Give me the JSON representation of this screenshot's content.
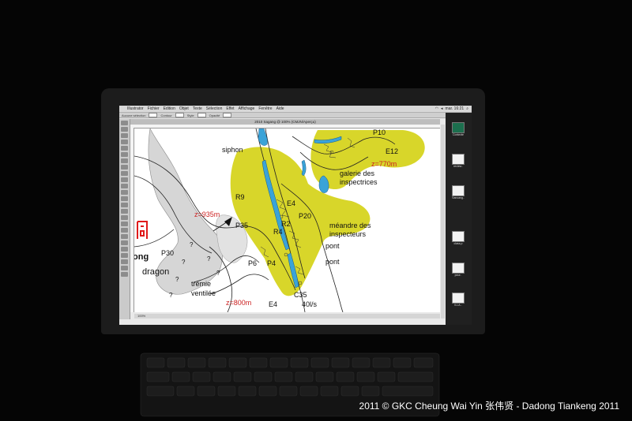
{
  "menubar": {
    "app_name": "Illustrator",
    "items": [
      "Fichier",
      "Edition",
      "Objet",
      "Texte",
      "Sélection",
      "Effet",
      "Affichage",
      "Fenêtre",
      "Aide"
    ],
    "clock": "mar. 16:21"
  },
  "options_bar": {
    "selection_label": "Aucune sélection",
    "fill_label": "Contour",
    "style_label": "Style",
    "opacity_label": "Opacité"
  },
  "document": {
    "title": "2010 Sagang @ 100% (CMJN/Aperçu)"
  },
  "statusbar": {
    "zoom": "100%"
  },
  "map": {
    "labels": {
      "siphon": "siphon",
      "p10": "P10",
      "e12": "E12",
      "z770": "z=770m",
      "galerie1": "galerie des",
      "galerie2": "inspectrices",
      "r9": "R9",
      "e4_top": "E4",
      "p20": "P20",
      "meandre1": "méandre des",
      "meandre2": "inspecteurs",
      "z935": "z=935m",
      "p35": "P35",
      "r2": "R2",
      "r4": "R4",
      "pont1": "pont",
      "pont2": "pont",
      "p30": "P30",
      "ong": "ong",
      "dragon": "dragon",
      "p6": "P6",
      "p4": "P4",
      "tremie1": "trémie",
      "tremie2": "ventilée",
      "c35": "C35",
      "flow": "40l/s",
      "z800": "z=800m",
      "e4_bottom": "E4",
      "grille": "grille"
    }
  },
  "desktop_icons": [
    {
      "label": "Contexte",
      "color": "#1c6f4e"
    },
    {
      "label": "review..",
      "color": "#f2f2f2"
    },
    {
      "label": "Sancang..",
      "color": "#f2f2f2"
    },
    {
      "label": "class.p",
      "color": "#f2f2f2"
    },
    {
      "label": "pour..",
      "color": "#f2f2f2"
    },
    {
      "label": "ILLA..",
      "color": "#f2f2f2"
    }
  ],
  "copyright": "2011 © GKC Cheung Wai Yin 张伟贤 - Dadong Tiankeng 2011",
  "colors": {
    "highlight": "#d8d62a",
    "water": "#3aa3d8",
    "altitude": "#cc2222",
    "accent_red": "#e01a1a"
  }
}
